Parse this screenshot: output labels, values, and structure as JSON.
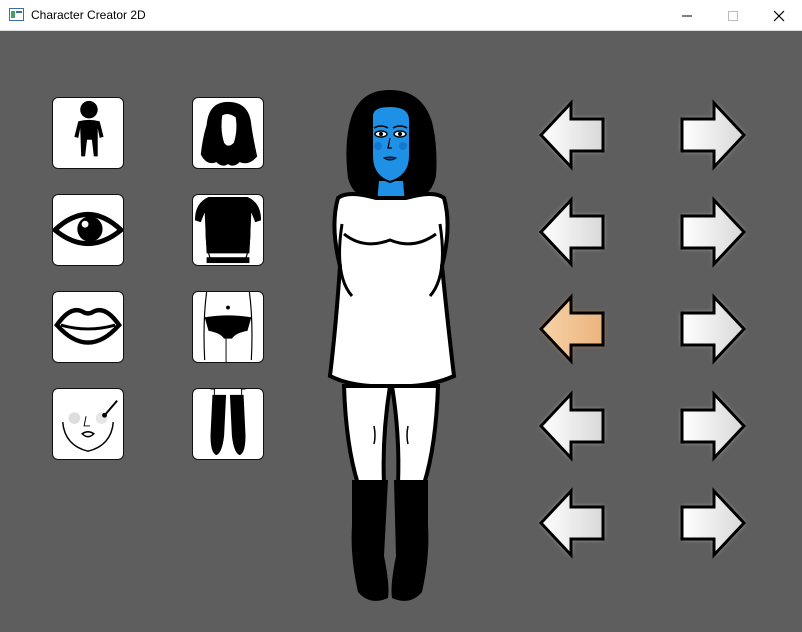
{
  "window": {
    "title": "Character Creator 2D",
    "controls": {
      "minimize": "minimize",
      "maximize": "maximize",
      "close": "close"
    }
  },
  "categories_left": [
    {
      "name": "body-category-icon"
    },
    {
      "name": "eyes-category-icon"
    },
    {
      "name": "lips-category-icon"
    },
    {
      "name": "makeup-category-icon"
    }
  ],
  "categories_right": [
    {
      "name": "hair-category-icon"
    },
    {
      "name": "top-category-icon"
    },
    {
      "name": "bottom-category-icon"
    },
    {
      "name": "shoes-category-icon"
    }
  ],
  "character": {
    "skin_color": "#1e90e6",
    "outfit": "white dress",
    "shoes": "black boots",
    "hair": "black"
  },
  "arrows": [
    {
      "row": 1,
      "left": "previous",
      "right": "next",
      "left_state": "normal"
    },
    {
      "row": 2,
      "left": "previous",
      "right": "next",
      "left_state": "normal"
    },
    {
      "row": 3,
      "left": "previous",
      "right": "next",
      "left_state": "highlighted"
    },
    {
      "row": 4,
      "left": "previous",
      "right": "next",
      "left_state": "normal"
    },
    {
      "row": 5,
      "left": "previous",
      "right": "next",
      "left_state": "normal"
    }
  ],
  "colors": {
    "background": "#5e5e5e",
    "highlight": "#e08a3c",
    "skin": "#1e90e6"
  }
}
